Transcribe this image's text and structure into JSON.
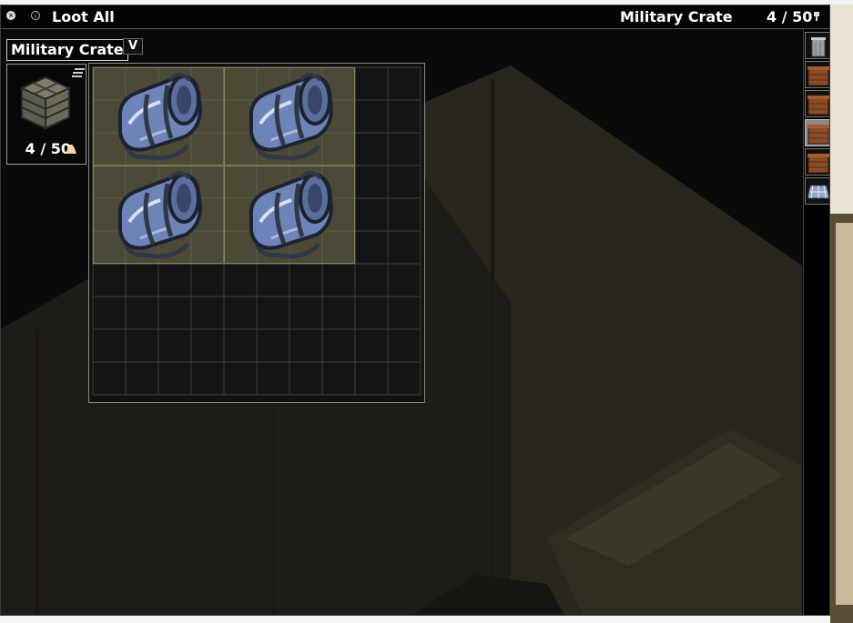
{
  "window": {
    "loot_all_label": "Loot All",
    "title": "Military Crate",
    "capacity": "4 / 50",
    "close_icon": "close-icon",
    "info_icon": "info-icon",
    "pin_icon": "pin-icon"
  },
  "container": {
    "name": "Military Crate",
    "collapse_label": "V",
    "capacity": "4 / 50",
    "icon": "military-crate-icon",
    "weight_icon": "weight-icon",
    "sort_icon": "sort-icon"
  },
  "grid": {
    "columns": 10,
    "rows": 10,
    "items": [
      {
        "name": "Duffel Bag",
        "icon": "duffel-bag-icon",
        "col": 0,
        "row": 0,
        "w": 4,
        "h": 3
      },
      {
        "name": "Duffel Bag",
        "icon": "duffel-bag-icon",
        "col": 4,
        "row": 0,
        "w": 4,
        "h": 3
      },
      {
        "name": "Duffel Bag",
        "icon": "duffel-bag-icon",
        "col": 0,
        "row": 3,
        "w": 4,
        "h": 3
      },
      {
        "name": "Duffel Bag",
        "icon": "duffel-bag-icon",
        "col": 4,
        "row": 3,
        "w": 4,
        "h": 3
      }
    ]
  },
  "side_tabs": [
    {
      "icon": "trash-can-icon",
      "selected": false
    },
    {
      "icon": "wooden-crate-icon",
      "selected": false
    },
    {
      "icon": "wooden-crate-icon",
      "selected": false
    },
    {
      "icon": "wooden-crate-icon",
      "selected": true
    },
    {
      "icon": "wooden-crate-icon",
      "selected": false
    },
    {
      "icon": "floor-tile-icon",
      "selected": false
    }
  ],
  "colors": {
    "item_cell_bg": "#4c4a37",
    "empty_cell_bg": "#141414",
    "grid_line": "#3f3f3f",
    "item_border": "#868262",
    "bag_blue": "#6d84b8",
    "bag_dark": "#303848",
    "crate_wood": "#8a4c24",
    "window_bg": "#090909"
  }
}
